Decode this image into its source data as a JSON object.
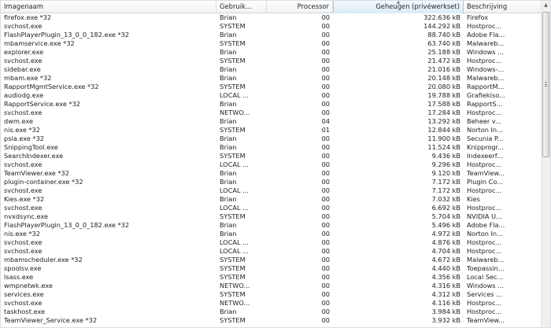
{
  "columns": {
    "name": "Imagenaam",
    "user": "Gebruik...",
    "cpu": "Processor",
    "memory": "Geheugen (privéwerkset)",
    "description": "Beschrijving"
  },
  "sorted_column": "memory",
  "processes": [
    {
      "name": "firefox.exe *32",
      "user": "Brian",
      "cpu": "00",
      "memory": "322.636 kB",
      "description": "Firefox"
    },
    {
      "name": "svchost.exe",
      "user": "SYSTEM",
      "cpu": "00",
      "memory": "144.292 kB",
      "description": "Hostproc..."
    },
    {
      "name": "FlashPlayerPlugin_13_0_0_182.exe *32",
      "user": "Brian",
      "cpu": "00",
      "memory": "88.740 kB",
      "description": "Adobe Fla..."
    },
    {
      "name": "mbamservice.exe *32",
      "user": "SYSTEM",
      "cpu": "00",
      "memory": "63.740 kB",
      "description": "Malwareb..."
    },
    {
      "name": "explorer.exe",
      "user": "Brian",
      "cpu": "00",
      "memory": "25.188 kB",
      "description": "Windows ..."
    },
    {
      "name": "svchost.exe",
      "user": "SYSTEM",
      "cpu": "00",
      "memory": "21.472 kB",
      "description": "Hostproc..."
    },
    {
      "name": "sidebar.exe",
      "user": "Brian",
      "cpu": "00",
      "memory": "21.016 kB",
      "description": "Windows-..."
    },
    {
      "name": "mbam.exe *32",
      "user": "Brian",
      "cpu": "00",
      "memory": "20.148 kB",
      "description": "Malwareb..."
    },
    {
      "name": "RapportMgmtService.exe *32",
      "user": "SYSTEM",
      "cpu": "00",
      "memory": "20.080 kB",
      "description": "RapportM..."
    },
    {
      "name": "audiodg.exe",
      "user": "LOCAL ...",
      "cpu": "00",
      "memory": "19.788 kB",
      "description": "Grafiekiso..."
    },
    {
      "name": "RapportService.exe *32",
      "user": "Brian",
      "cpu": "00",
      "memory": "17.588 kB",
      "description": "RapportS..."
    },
    {
      "name": "svchost.exe",
      "user": "NETWO...",
      "cpu": "00",
      "memory": "17.284 kB",
      "description": "Hostproc..."
    },
    {
      "name": "dwm.exe",
      "user": "Brian",
      "cpu": "04",
      "memory": "13.292 kB",
      "description": "Beheer v..."
    },
    {
      "name": "nis.exe *32",
      "user": "SYSTEM",
      "cpu": "01",
      "memory": "12.844 kB",
      "description": "Norton In..."
    },
    {
      "name": "psia.exe *32",
      "user": "Brian",
      "cpu": "00",
      "memory": "11.900 kB",
      "description": "Secunia P..."
    },
    {
      "name": "SnippingTool.exe",
      "user": "Brian",
      "cpu": "00",
      "memory": "11.524 kB",
      "description": "Knipprogr..."
    },
    {
      "name": "SearchIndexer.exe",
      "user": "SYSTEM",
      "cpu": "00",
      "memory": "9.436 kB",
      "description": "Indexeerf..."
    },
    {
      "name": "svchost.exe",
      "user": "LOCAL ...",
      "cpu": "00",
      "memory": "9.296 kB",
      "description": "Hostproc..."
    },
    {
      "name": "TeamViewer.exe *32",
      "user": "Brian",
      "cpu": "00",
      "memory": "9.120 kB",
      "description": "TeamView..."
    },
    {
      "name": "plugin-container.exe *32",
      "user": "Brian",
      "cpu": "00",
      "memory": "7.172 kB",
      "description": "Plugin Co..."
    },
    {
      "name": "svchost.exe",
      "user": "LOCAL ...",
      "cpu": "00",
      "memory": "7.172 kB",
      "description": "Hostproc..."
    },
    {
      "name": "Kies.exe *32",
      "user": "Brian",
      "cpu": "00",
      "memory": "7.032 kB",
      "description": "Kies"
    },
    {
      "name": "svchost.exe",
      "user": "LOCAL ...",
      "cpu": "00",
      "memory": "6.692 kB",
      "description": "Hostproc..."
    },
    {
      "name": "nvxdsync.exe",
      "user": "SYSTEM",
      "cpu": "00",
      "memory": "5.704 kB",
      "description": "NVIDIA U..."
    },
    {
      "name": "FlashPlayerPlugin_13_0_0_182.exe *32",
      "user": "Brian",
      "cpu": "00",
      "memory": "5.496 kB",
      "description": "Adobe Fla..."
    },
    {
      "name": "nis.exe *32",
      "user": "Brian",
      "cpu": "00",
      "memory": "4.972 kB",
      "description": "Norton In..."
    },
    {
      "name": "svchost.exe",
      "user": "LOCAL ...",
      "cpu": "00",
      "memory": "4.876 kB",
      "description": "Hostproc..."
    },
    {
      "name": "svchost.exe",
      "user": "LOCAL ...",
      "cpu": "00",
      "memory": "4.704 kB",
      "description": "Hostproc..."
    },
    {
      "name": "mbamscheduler.exe *32",
      "user": "SYSTEM",
      "cpu": "00",
      "memory": "4.672 kB",
      "description": "Malwareb..."
    },
    {
      "name": "spoolsv.exe",
      "user": "SYSTEM",
      "cpu": "00",
      "memory": "4.440 kB",
      "description": "Toepassin..."
    },
    {
      "name": "lsass.exe",
      "user": "SYSTEM",
      "cpu": "00",
      "memory": "4.356 kB",
      "description": "Local Sec..."
    },
    {
      "name": "wmpnetwk.exe",
      "user": "NETWO...",
      "cpu": "00",
      "memory": "4.316 kB",
      "description": "Windows ..."
    },
    {
      "name": "services.exe",
      "user": "SYSTEM",
      "cpu": "00",
      "memory": "4.312 kB",
      "description": "Services ..."
    },
    {
      "name": "svchost.exe",
      "user": "NETWO...",
      "cpu": "00",
      "memory": "4.116 kB",
      "description": "Hostproc..."
    },
    {
      "name": "taskhost.exe",
      "user": "Brian",
      "cpu": "00",
      "memory": "3.984 kB",
      "description": "Hostproc..."
    },
    {
      "name": "TeamViewer_Service.exe *32",
      "user": "SYSTEM",
      "cpu": "00",
      "memory": "3.932 kB",
      "description": "TeamView..."
    }
  ]
}
